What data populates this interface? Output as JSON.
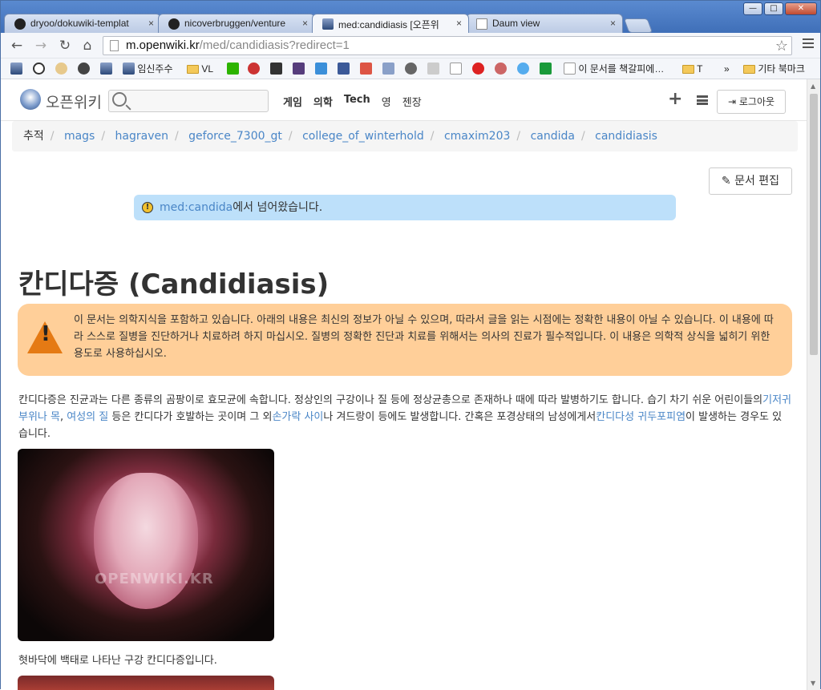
{
  "browser": {
    "tabs": [
      {
        "title": "dryoo/dokuwiki-templat",
        "active": false
      },
      {
        "title": "nicoverbruggen/venture",
        "active": false
      },
      {
        "title": "med:candidiasis [오픈위",
        "active": true
      },
      {
        "title": "Daum view",
        "active": false
      }
    ],
    "url_host": "m.openwiki.kr",
    "url_path": "/med/candidiasis?redirect=1",
    "bookmarks": {
      "b1": "임신주수",
      "b2": "VL",
      "b3": "이 문서를 책갈피에…",
      "b4": "T",
      "more": "»",
      "other": "기타 북마크"
    }
  },
  "site": {
    "brand": "오픈위키",
    "nav": [
      "게임",
      "의학",
      "Tech",
      "영",
      "젠장"
    ],
    "logout": "로그아웃"
  },
  "breadcrumb": {
    "label": "추적",
    "items": [
      "mags",
      "hagraven",
      "geforce_7300_gt",
      "college_of_winterhold",
      "cmaxim203",
      "candida",
      "candidiasis"
    ]
  },
  "edit_button": "문서 편집",
  "redirect": {
    "link": "med:candida",
    "text": "에서 넘어왔습니다."
  },
  "article": {
    "title": "칸디다증 (Candidiasis)",
    "warning": "이 문서는 의학지식을 포함하고 있습니다. 아래의 내용은 최신의 정보가 아닐 수 있으며, 따라서 글을 읽는 시점에는 정확한 내용이 아닐 수 있습니다. 이 내용에 따라 스스로 질병을 진단하거나 치료하려 하지 마십시오. 질병의 정확한 진단과 치료를 위해서는 의사의 진료가 필수적입니다. 이 내용은 의학적 상식을 넓히기 위한 용도로 사용하십시오.",
    "p1": "칸디다증은 진균과는 다른 종류의 곰팡이로 효모균에 속합니다. 정상인의 구강이나 질 등에 정상균총으로 존재하나 때에 따라 발병하기도 합니다. 습기 차기 쉬운 어린이들의",
    "link1": "기저귀 부위나 목",
    "sep1": ", ",
    "link2": "여성의 질",
    "p2": " 등은 칸디다가 호발하는 곳이며 그 외",
    "link3": "손가락 사이",
    "p3": "나 겨드랑이 등에도 발생합니다. 간혹은 포경상태의 남성에게서",
    "link4": "칸디다성 귀두포피염",
    "p4": "이 발생하는 경우도 있습니다.",
    "image_watermark": "OPENWIKI.KR",
    "caption": "혓바닥에 백태로 나타난 구강 칸디다증입니다."
  }
}
